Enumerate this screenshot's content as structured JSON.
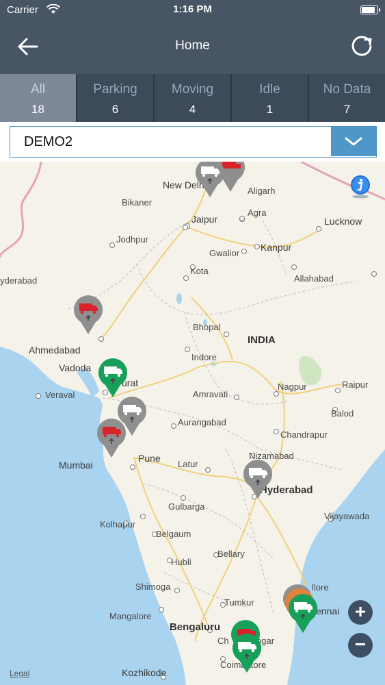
{
  "status_bar": {
    "carrier": "Carrier",
    "time": "1:16 PM"
  },
  "header": {
    "title": "Home",
    "back_icon": "arrow-left-icon",
    "refresh_icon": "refresh-icon"
  },
  "tabs": [
    {
      "label": "All",
      "count": "18"
    },
    {
      "label": "Parking",
      "count": "6"
    },
    {
      "label": "Moving",
      "count": "4"
    },
    {
      "label": "Idle",
      "count": "1"
    },
    {
      "label": "No Data",
      "count": "7"
    }
  ],
  "dropdown": {
    "selected": "DEMO2"
  },
  "map": {
    "legal": "Legal",
    "cities": {
      "new_delhi": "New Delhi",
      "aligarh": "Aligarh",
      "bikaner": "Bikaner",
      "jaipur": "Jaipur",
      "agra": "Agra",
      "lucknow": "Lucknow",
      "jodhpur": "Jodhpur",
      "kanpur": "Kanpur",
      "gwalior": "Gwalior",
      "hyderabad_pk": "yderabad",
      "kota": "Kota",
      "allahabad": "Allahabad",
      "bhopal": "Bhopal",
      "india": "INDIA",
      "ahmedabad": "Ahmedabad",
      "vadodara": "Vadoda",
      "indore": "Indore",
      "surat": "urat",
      "nagpur": "Nagpur",
      "raipur": "Raipur",
      "veraval": "Veraval",
      "amravati": "Amravati",
      "balod": "Balod",
      "aurangabad": "Aurangabad",
      "chandrapur": "Chandrapur",
      "mumbai": "Mumbai",
      "pune": "Pune",
      "nizamabad": "Nizamabad",
      "latur": "Latur",
      "hyderabad": "Hyderabad",
      "gulbarga": "Gulbarga",
      "vijayawada": "Vijayawada",
      "kolhapur": "Kolhapur",
      "belgaum": "Belgaum",
      "bellary": "Bellary",
      "hubli": "Hubli",
      "nellore": "llore",
      "shimoga": "Shimoga",
      "tumkur": "Tumkur",
      "chennai": "ennai",
      "mangalore": "Mangalore",
      "bengaluru": "Bengaluru",
      "chamrajnagar": "Ch",
      "hosur": "ogar",
      "coimbatore": "Coimbatore",
      "kozhikode": "Kozhikode"
    },
    "pins": [
      {
        "status": "no-data",
        "color": "#8f8f8f",
        "truck": "#ffffff"
      },
      {
        "status": "parking",
        "color": "#8f8f8f",
        "truck": "#d9232a"
      },
      {
        "status": "moving",
        "color": "#17a05a",
        "truck": "#ffffff"
      },
      {
        "status": "no-data",
        "color": "#8f8f8f",
        "truck": "#ffffff"
      },
      {
        "status": "parking",
        "color": "#8f8f8f",
        "truck": "#d9232a"
      },
      {
        "status": "no-data",
        "color": "#8f8f8f",
        "truck": "#ffffff"
      },
      {
        "status": "moving",
        "color": "#17a05a",
        "truck": "#ffffff"
      },
      {
        "status": "moving",
        "color": "#17a05a",
        "truck": "#ffffff"
      }
    ]
  }
}
